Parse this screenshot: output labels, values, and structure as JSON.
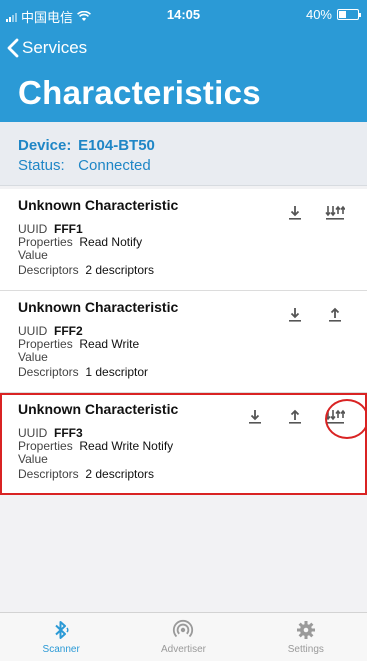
{
  "status_bar": {
    "carrier": "中国电信",
    "time": "14:05",
    "battery": "40%",
    "battery_level": 0.4
  },
  "nav": {
    "back_label": "Services",
    "title": "Characteristics"
  },
  "device": {
    "device_key": "Device:",
    "device_value": "E104-BT50",
    "status_key": "Status:",
    "status_value": "Connected"
  },
  "characteristics": [
    {
      "name": "Unknown Characteristic",
      "uuid_label": "UUID",
      "uuid": "FFF1",
      "properties_label": "Properties",
      "properties": "Read Notify",
      "value_label": "Value",
      "descriptors_label": "Descriptors",
      "descriptors": "2 descriptors",
      "actions": [
        "read-icon",
        "notify-icon"
      ]
    },
    {
      "name": "Unknown Characteristic",
      "uuid_label": "UUID",
      "uuid": "FFF2",
      "properties_label": "Properties",
      "properties": "Read Write",
      "value_label": "Value",
      "descriptors_label": "Descriptors",
      "descriptors": "1 descriptor",
      "actions": [
        "read-icon",
        "write-icon"
      ]
    },
    {
      "name": "Unknown Characteristic",
      "uuid_label": "UUID",
      "uuid": "FFF3",
      "properties_label": "Properties",
      "properties": "Read Write Notify",
      "value_label": "Value",
      "descriptors_label": "Descriptors",
      "descriptors": "2 descriptors",
      "actions": [
        "read-icon",
        "write-icon",
        "notify-icon"
      ]
    }
  ],
  "tabs": [
    {
      "label": "Scanner",
      "icon": "bluetooth-icon",
      "active": true
    },
    {
      "label": "Advertiser",
      "icon": "broadcast-icon",
      "active": false
    },
    {
      "label": "Settings",
      "icon": "gear-icon",
      "active": false
    }
  ],
  "colors": {
    "brand": "#2b9ad6",
    "highlight": "#d92323",
    "device_text": "#1f86c6"
  }
}
